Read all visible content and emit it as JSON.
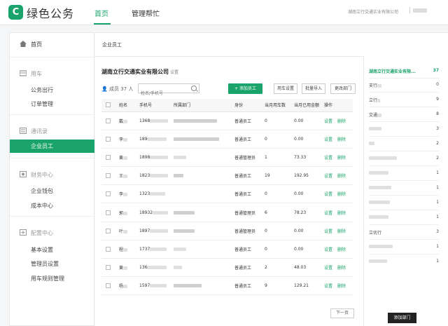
{
  "app": {
    "logo_letter": "C",
    "name": "绿色公务",
    "accent": "#1aa36a",
    "nav": [
      "首页",
      "管理帮忙"
    ],
    "company": "湖南立行交通实业有限公司"
  },
  "sidebar": {
    "home": "首页",
    "car": {
      "title": "用车",
      "items": [
        "公务出行",
        "订单管理"
      ]
    },
    "contacts": {
      "title": "通讯录",
      "active_item": "企业员工"
    },
    "finance": {
      "title": "财务中心",
      "items": [
        "企业钱包",
        "成本中心"
      ]
    },
    "config": {
      "title": "配置中心",
      "items": [
        "基本设置",
        "管理员设置",
        "用车规则管理"
      ]
    }
  },
  "main": {
    "breadcrumb": "企业员工",
    "company_name": "湖南立行交通实业有限公司",
    "settings_link": "设置",
    "member_label": "成员",
    "member_count": "37 人",
    "search_placeholder": "姓名/手机号",
    "buttons": {
      "add_employee": "添加员工",
      "car_settings": "用车设置",
      "batch_import": "批量导入",
      "change_dept": "更改部门"
    },
    "table": {
      "headers": [
        "姓名",
        "手机号",
        "所属部门",
        "身份",
        "当月用车数",
        "当月已用金额",
        "操作"
      ],
      "rows": [
        {
          "name": "戴",
          "phone": "1368",
          "role": "普通员工",
          "count": "0",
          "amount": "0.00"
        },
        {
          "name": "李",
          "phone": "189",
          "role": "普通员工",
          "count": "0",
          "amount": "0.00"
        },
        {
          "name": "黄",
          "phone": "1898",
          "role": "普通管理员",
          "count": "1",
          "amount": "73.33"
        },
        {
          "name": "王",
          "phone": "1823",
          "role": "普通员工",
          "count": "19",
          "amount": "192.95"
        },
        {
          "name": "李",
          "phone": "1323",
          "role": "普通员工",
          "count": "0",
          "amount": "0.00"
        },
        {
          "name": "郭",
          "phone": "18932",
          "role": "普通管理员",
          "count": "6",
          "amount": "78.23"
        },
        {
          "name": "叶",
          "phone": "1897",
          "role": "普通管理员",
          "count": "0",
          "amount": "0.00"
        },
        {
          "name": "程",
          "phone": "1737",
          "role": "普通员工",
          "count": "0",
          "amount": "0.00"
        },
        {
          "name": "黄",
          "phone": "136",
          "role": "普通员工",
          "count": "2",
          "amount": "48.03"
        },
        {
          "name": "杨",
          "phone": "1597",
          "role": "普通员工",
          "count": "9",
          "amount": "129.21"
        }
      ],
      "op_set": "设置",
      "op_delete": "删除"
    },
    "next_page": "下一页"
  },
  "departments": {
    "active": {
      "name": "湖南立行交通实业有限...",
      "count": "37"
    },
    "items": [
      {
        "name": "支行",
        "count": "0"
      },
      {
        "name": "立行",
        "count": "9"
      },
      {
        "name": "交通",
        "count": "8"
      },
      {
        "name": "",
        "count": "3"
      },
      {
        "name": "",
        "count": "2"
      },
      {
        "name": "",
        "count": "2"
      },
      {
        "name": "",
        "count": "1"
      },
      {
        "name": "",
        "count": "1"
      },
      {
        "name": "",
        "count": "1"
      },
      {
        "name": "",
        "count": "1"
      },
      {
        "name": "立优行",
        "count": "3"
      },
      {
        "name": "",
        "count": "1"
      },
      {
        "name": "",
        "count": "1"
      }
    ],
    "add_button": "添加部门"
  }
}
